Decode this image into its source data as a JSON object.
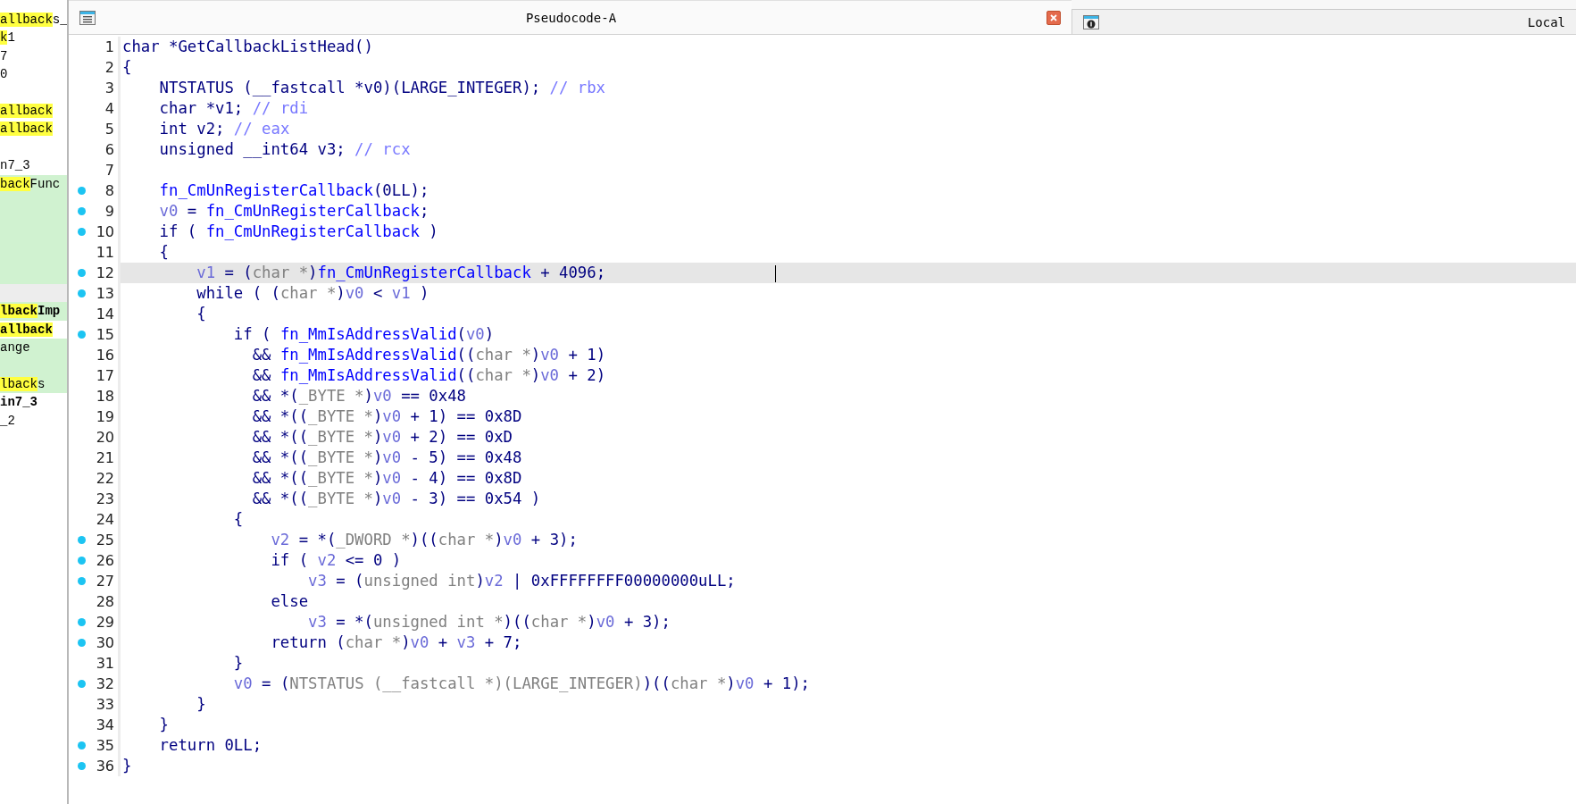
{
  "functions": [
    {
      "parts": [
        {
          "text": "allback",
          "match": true
        },
        {
          "text": "s_",
          "match": false
        }
      ],
      "bold": false
    },
    {
      "parts": [
        {
          "text": "k",
          "match": true
        },
        {
          "text": "1",
          "match": false
        }
      ],
      "bold": false
    },
    {
      "parts": [
        {
          "text": "7",
          "match": false
        }
      ],
      "bold": false
    },
    {
      "parts": [
        {
          "text": "0",
          "match": false
        }
      ],
      "bold": false
    },
    {
      "kind": "blank"
    },
    {
      "parts": [
        {
          "text": "allback",
          "match": true
        }
      ],
      "bold": false
    },
    {
      "parts": [
        {
          "text": "allback",
          "match": true
        }
      ],
      "bold": false
    },
    {
      "kind": "blank"
    },
    {
      "parts": [
        {
          "text": "n7_3",
          "match": false
        }
      ],
      "bold": false
    },
    {
      "parts": [
        {
          "text": "back",
          "match": true
        },
        {
          "text": "Func",
          "match": false
        }
      ],
      "color": "#d0f2d0",
      "bold": false
    },
    {
      "kind": "blank",
      "color": "#d0f2d0"
    },
    {
      "kind": "blank",
      "color": "#d0f2d0"
    },
    {
      "kind": "blank",
      "color": "#d0f2d0"
    },
    {
      "kind": "blank",
      "color": "#d0f2d0"
    },
    {
      "kind": "blank",
      "color": "#d0f2d0"
    },
    {
      "kind": "blank",
      "color": "#ededed"
    },
    {
      "parts": [
        {
          "text": "lback",
          "match": true
        },
        {
          "text": "Imp",
          "match": false
        }
      ],
      "color": "#d0f2d0",
      "bold": true
    },
    {
      "parts": [
        {
          "text": "allback",
          "match": true
        }
      ],
      "bold": true
    },
    {
      "parts": [
        {
          "text": "ange",
          "match": false
        }
      ],
      "color": "#d0f2d0",
      "bold": false
    },
    {
      "kind": "blank",
      "color": "#d0f2d0"
    },
    {
      "parts": [
        {
          "text": "lback",
          "match": true
        },
        {
          "text": "s",
          "match": false
        }
      ],
      "color": "#d0f2d0",
      "bold": false
    },
    {
      "parts": [
        {
          "text": "in7_3",
          "match": false
        }
      ],
      "bold": true
    },
    {
      "parts": [
        {
          "text": "_2",
          "match": false
        }
      ],
      "bold": false
    }
  ],
  "tabs": [
    {
      "title": "Pseudocode-A",
      "selected": true,
      "closable": true
    },
    {
      "title": "Local",
      "selected": false,
      "closable": false
    }
  ],
  "lines": [
    {
      "number": "1",
      "breakpoint": false,
      "highlighted": false,
      "tokens": [
        {
          "kind": "code",
          "text": "char *GetCallbackListHead()"
        }
      ]
    },
    {
      "number": "2",
      "breakpoint": false,
      "highlighted": false,
      "tokens": [
        {
          "kind": "code",
          "text": "{"
        }
      ]
    },
    {
      "number": "3",
      "breakpoint": false,
      "highlighted": false,
      "tokens": [
        {
          "kind": "code",
          "text": "    NTSTATUS (__fastcall *v0)(LARGE_INTEGER); "
        },
        {
          "kind": "comment",
          "text": "// rbx"
        }
      ]
    },
    {
      "number": "4",
      "breakpoint": false,
      "highlighted": false,
      "tokens": [
        {
          "kind": "code",
          "text": "    char *v1; "
        },
        {
          "kind": "comment",
          "text": "// rdi"
        }
      ]
    },
    {
      "number": "5",
      "breakpoint": false,
      "highlighted": false,
      "tokens": [
        {
          "kind": "code",
          "text": "    int v2; "
        },
        {
          "kind": "comment",
          "text": "// eax"
        }
      ]
    },
    {
      "number": "6",
      "breakpoint": false,
      "highlighted": false,
      "tokens": [
        {
          "kind": "code",
          "text": "    unsigned __int64 v3; "
        },
        {
          "kind": "comment",
          "text": "// rcx"
        }
      ]
    },
    {
      "number": "7",
      "breakpoint": false,
      "highlighted": false
    },
    {
      "number": "8",
      "breakpoint": true,
      "highlighted": false,
      "tokens": [
        {
          "kind": "func",
          "text": "    fn_CmUnRegisterCallback"
        },
        {
          "kind": "code",
          "text": "(0LL);"
        }
      ]
    },
    {
      "number": "9",
      "breakpoint": true,
      "highlighted": false,
      "tokens": [
        {
          "kind": "var",
          "text": "    v0"
        },
        {
          "kind": "code",
          "text": " = "
        },
        {
          "kind": "func",
          "text": "fn_CmUnRegisterCallback"
        },
        {
          "kind": "code",
          "text": ";"
        }
      ]
    },
    {
      "number": "10",
      "breakpoint": true,
      "highlighted": false,
      "tokens": [
        {
          "kind": "code",
          "text": "    if ( "
        },
        {
          "kind": "func",
          "text": "fn_CmUnRegisterCallback"
        },
        {
          "kind": "code",
          "text": " )"
        }
      ]
    },
    {
      "number": "11",
      "breakpoint": false,
      "highlighted": false,
      "tokens": [
        {
          "kind": "code",
          "text": "    {"
        }
      ]
    },
    {
      "number": "12",
      "breakpoint": true,
      "highlighted": true,
      "cursor": true,
      "tokens": [
        {
          "kind": "var",
          "text": "        v1"
        },
        {
          "kind": "code",
          "text": " = ("
        },
        {
          "kind": "cast",
          "text": "char *"
        },
        {
          "kind": "code",
          "text": ")"
        },
        {
          "kind": "func",
          "text": "fn_CmUnRegisterCallback"
        },
        {
          "kind": "code",
          "text": " + 4096;"
        }
      ]
    },
    {
      "number": "13",
      "breakpoint": true,
      "highlighted": false,
      "tokens": [
        {
          "kind": "code",
          "text": "        while ( ("
        },
        {
          "kind": "cast",
          "text": "char *"
        },
        {
          "kind": "code",
          "text": ")"
        },
        {
          "kind": "var",
          "text": "v0"
        },
        {
          "kind": "code",
          "text": " < "
        },
        {
          "kind": "var",
          "text": "v1"
        },
        {
          "kind": "code",
          "text": " )"
        }
      ]
    },
    {
      "number": "14",
      "breakpoint": false,
      "highlighted": false,
      "tokens": [
        {
          "kind": "code",
          "text": "        {"
        }
      ]
    },
    {
      "number": "15",
      "breakpoint": true,
      "highlighted": false,
      "tokens": [
        {
          "kind": "code",
          "text": "            if ( "
        },
        {
          "kind": "func",
          "text": "fn_MmIsAddressValid"
        },
        {
          "kind": "code",
          "text": "("
        },
        {
          "kind": "var",
          "text": "v0"
        },
        {
          "kind": "code",
          "text": ")"
        }
      ]
    },
    {
      "number": "16",
      "breakpoint": false,
      "highlighted": false,
      "tokens": [
        {
          "kind": "code",
          "text": "              && "
        },
        {
          "kind": "func",
          "text": "fn_MmIsAddressValid"
        },
        {
          "kind": "code",
          "text": "(("
        },
        {
          "kind": "cast",
          "text": "char *"
        },
        {
          "kind": "code",
          "text": ")"
        },
        {
          "kind": "var",
          "text": "v0"
        },
        {
          "kind": "code",
          "text": " + 1)"
        }
      ]
    },
    {
      "number": "17",
      "breakpoint": false,
      "highlighted": false,
      "tokens": [
        {
          "kind": "code",
          "text": "              && "
        },
        {
          "kind": "func",
          "text": "fn_MmIsAddressValid"
        },
        {
          "kind": "code",
          "text": "(("
        },
        {
          "kind": "cast",
          "text": "char *"
        },
        {
          "kind": "code",
          "text": ")"
        },
        {
          "kind": "var",
          "text": "v0"
        },
        {
          "kind": "code",
          "text": " + 2)"
        }
      ]
    },
    {
      "number": "18",
      "breakpoint": false,
      "highlighted": false,
      "tokens": [
        {
          "kind": "code",
          "text": "              && *("
        },
        {
          "kind": "cast",
          "text": "_BYTE *"
        },
        {
          "kind": "code",
          "text": ")"
        },
        {
          "kind": "var",
          "text": "v0"
        },
        {
          "kind": "code",
          "text": " == 0x48"
        }
      ]
    },
    {
      "number": "19",
      "breakpoint": false,
      "highlighted": false,
      "tokens": [
        {
          "kind": "code",
          "text": "              && *(("
        },
        {
          "kind": "cast",
          "text": "_BYTE *"
        },
        {
          "kind": "code",
          "text": ")"
        },
        {
          "kind": "var",
          "text": "v0"
        },
        {
          "kind": "code",
          "text": " + 1) == 0x8D"
        }
      ]
    },
    {
      "number": "20",
      "breakpoint": false,
      "highlighted": false,
      "tokens": [
        {
          "kind": "code",
          "text": "              && *(("
        },
        {
          "kind": "cast",
          "text": "_BYTE *"
        },
        {
          "kind": "code",
          "text": ")"
        },
        {
          "kind": "var",
          "text": "v0"
        },
        {
          "kind": "code",
          "text": " + 2) == 0xD"
        }
      ]
    },
    {
      "number": "21",
      "breakpoint": false,
      "highlighted": false,
      "tokens": [
        {
          "kind": "code",
          "text": "              && *(("
        },
        {
          "kind": "cast",
          "text": "_BYTE *"
        },
        {
          "kind": "code",
          "text": ")"
        },
        {
          "kind": "var",
          "text": "v0"
        },
        {
          "kind": "code",
          "text": " - 5) == 0x48"
        }
      ]
    },
    {
      "number": "22",
      "breakpoint": false,
      "highlighted": false,
      "tokens": [
        {
          "kind": "code",
          "text": "              && *(("
        },
        {
          "kind": "cast",
          "text": "_BYTE *"
        },
        {
          "kind": "code",
          "text": ")"
        },
        {
          "kind": "var",
          "text": "v0"
        },
        {
          "kind": "code",
          "text": " - 4) == 0x8D"
        }
      ]
    },
    {
      "number": "23",
      "breakpoint": false,
      "highlighted": false,
      "tokens": [
        {
          "kind": "code",
          "text": "              && *(("
        },
        {
          "kind": "cast",
          "text": "_BYTE *"
        },
        {
          "kind": "code",
          "text": ")"
        },
        {
          "kind": "var",
          "text": "v0"
        },
        {
          "kind": "code",
          "text": " - 3) == 0x54 )"
        }
      ]
    },
    {
      "number": "24",
      "breakpoint": false,
      "highlighted": false,
      "tokens": [
        {
          "kind": "code",
          "text": "            {"
        }
      ]
    },
    {
      "number": "25",
      "breakpoint": true,
      "highlighted": false,
      "tokens": [
        {
          "kind": "var",
          "text": "                v2"
        },
        {
          "kind": "code",
          "text": " = *("
        },
        {
          "kind": "cast",
          "text": "_DWORD *"
        },
        {
          "kind": "code",
          "text": ")(("
        },
        {
          "kind": "cast",
          "text": "char *"
        },
        {
          "kind": "code",
          "text": ")"
        },
        {
          "kind": "var",
          "text": "v0"
        },
        {
          "kind": "code",
          "text": " + 3);"
        }
      ]
    },
    {
      "number": "26",
      "breakpoint": true,
      "highlighted": false,
      "tokens": [
        {
          "kind": "code",
          "text": "                if ( "
        },
        {
          "kind": "var",
          "text": "v2"
        },
        {
          "kind": "code",
          "text": " <= 0 )"
        }
      ]
    },
    {
      "number": "27",
      "breakpoint": true,
      "highlighted": false,
      "tokens": [
        {
          "kind": "var",
          "text": "                    v3"
        },
        {
          "kind": "code",
          "text": " = ("
        },
        {
          "kind": "cast",
          "text": "unsigned int"
        },
        {
          "kind": "code",
          "text": ")"
        },
        {
          "kind": "var",
          "text": "v2"
        },
        {
          "kind": "code",
          "text": " | 0xFFFFFFFF00000000uLL;"
        }
      ]
    },
    {
      "number": "28",
      "breakpoint": false,
      "highlighted": false,
      "tokens": [
        {
          "kind": "code",
          "text": "                else"
        }
      ]
    },
    {
      "number": "29",
      "breakpoint": true,
      "highlighted": false,
      "tokens": [
        {
          "kind": "var",
          "text": "                    v3"
        },
        {
          "kind": "code",
          "text": " = *("
        },
        {
          "kind": "cast",
          "text": "unsigned int *"
        },
        {
          "kind": "code",
          "text": ")(("
        },
        {
          "kind": "cast",
          "text": "char *"
        },
        {
          "kind": "code",
          "text": ")"
        },
        {
          "kind": "var",
          "text": "v0"
        },
        {
          "kind": "code",
          "text": " + 3);"
        }
      ]
    },
    {
      "number": "30",
      "breakpoint": true,
      "highlighted": false,
      "tokens": [
        {
          "kind": "code",
          "text": "                return ("
        },
        {
          "kind": "cast",
          "text": "char *"
        },
        {
          "kind": "code",
          "text": ")"
        },
        {
          "kind": "var",
          "text": "v0"
        },
        {
          "kind": "code",
          "text": " + "
        },
        {
          "kind": "var",
          "text": "v3"
        },
        {
          "kind": "code",
          "text": " + 7;"
        }
      ]
    },
    {
      "number": "31",
      "breakpoint": false,
      "highlighted": false,
      "tokens": [
        {
          "kind": "code",
          "text": "            }"
        }
      ]
    },
    {
      "number": "32",
      "breakpoint": true,
      "highlighted": false,
      "tokens": [
        {
          "kind": "var",
          "text": "            v0"
        },
        {
          "kind": "code",
          "text": " = ("
        },
        {
          "kind": "cast",
          "text": "NTSTATUS (__fastcall *)(LARGE_INTEGER)"
        },
        {
          "kind": "code",
          "text": ")(("
        },
        {
          "kind": "cast",
          "text": "char *"
        },
        {
          "kind": "code",
          "text": ")"
        },
        {
          "kind": "var",
          "text": "v0"
        },
        {
          "kind": "code",
          "text": " + 1);"
        }
      ]
    },
    {
      "number": "33",
      "breakpoint": false,
      "highlighted": false,
      "tokens": [
        {
          "kind": "code",
          "text": "        }"
        }
      ]
    },
    {
      "number": "34",
      "breakpoint": false,
      "highlighted": false,
      "tokens": [
        {
          "kind": "code",
          "text": "    }"
        }
      ]
    },
    {
      "number": "35",
      "breakpoint": true,
      "highlighted": false,
      "tokens": [
        {
          "kind": "code",
          "text": "    return 0LL;"
        }
      ]
    },
    {
      "number": "36",
      "breakpoint": true,
      "highlighted": false,
      "tokens": [
        {
          "kind": "code",
          "text": "}"
        }
      ]
    }
  ]
}
